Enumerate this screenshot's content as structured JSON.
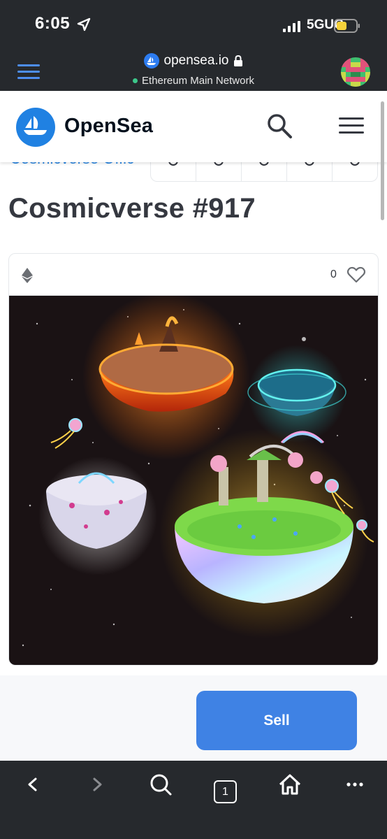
{
  "status": {
    "time": "6:05",
    "network": "5GUC"
  },
  "wallet_bar": {
    "url": "opensea.io",
    "network_name": "Ethereum Main Network"
  },
  "nav": {
    "brand": "OpenSea"
  },
  "collection_peek": "Cosmicverse Offic",
  "item": {
    "title": "Cosmicverse #917",
    "favorites": "0"
  },
  "sell": {
    "label": "Sell"
  },
  "toolbar": {
    "tab_count": "1"
  },
  "colors": {
    "accent": "#2081e2",
    "sell_button": "#3f82e4",
    "bar_dark": "#26292d",
    "network_dot": "#3cc78a"
  },
  "icons": [
    "location-arrow-icon",
    "signal-icon",
    "battery-icon",
    "menu-icon",
    "lock-icon",
    "search-icon",
    "ethereum-icon",
    "heart-icon",
    "back-icon",
    "forward-icon",
    "tabs-icon",
    "home-icon",
    "more-icon"
  ]
}
